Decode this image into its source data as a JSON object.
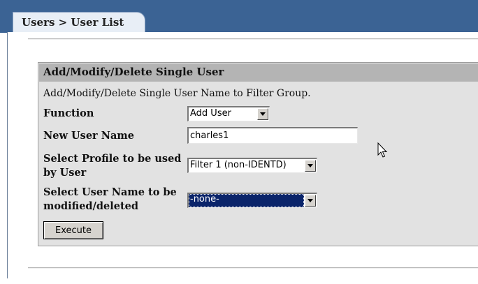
{
  "breadcrumb_tab": "Users > User List",
  "panel": {
    "title": "Add/Modify/Delete Single User",
    "description": "Add/Modify/Delete Single User Name to Filter Group."
  },
  "form": {
    "function_label": "Function",
    "function_value": "Add User",
    "new_user_label": "New User Name",
    "new_user_value": "charles1",
    "profile_label_line1": "Select Profile to be used",
    "profile_label_line2": "by User",
    "profile_value": "Filter 1 (non-IDENTD)",
    "modify_label_line1": "Select User Name to be",
    "modify_label_line2": "modified/deleted",
    "modify_value": "-none-",
    "execute_label": "Execute"
  },
  "icons": {
    "dropdown": "chevron-down-icon",
    "pointer": "mouse-pointer-icon"
  },
  "colors": {
    "frame": "#3b6394",
    "panel_bg": "#e2e2e2",
    "panel_header": "#b4b4b4",
    "selection": "#0a246a"
  }
}
